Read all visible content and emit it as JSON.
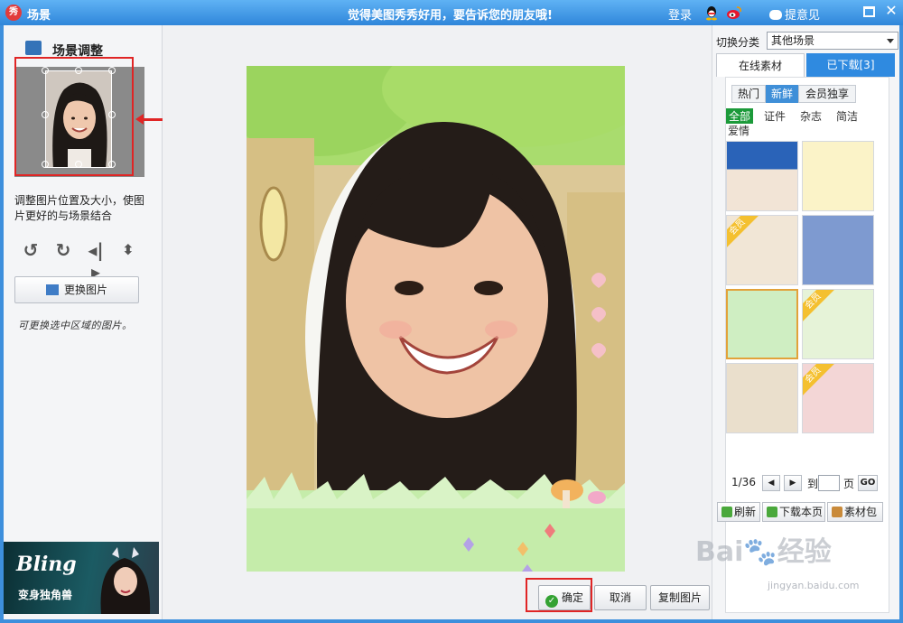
{
  "titlebar": {
    "title": "场景",
    "logo_text": "秀",
    "slogan": "觉得美图秀秀好用，要告诉您的朋友哦!",
    "login": "登录",
    "feedback": "提意见"
  },
  "left": {
    "title": "场景调整",
    "hint": "调整图片位置及大小，使图片更好的与场景结合",
    "replace_button": "更换图片",
    "handwritten": "可更换选中区域的图片。",
    "ad_title": "Bling",
    "ad_subtitle": "变身独角兽"
  },
  "center": {
    "ok": "确定",
    "cancel": "取消",
    "copy": "复制图片"
  },
  "right": {
    "category_label": "切换分类",
    "category_value": "其他场景",
    "tab_online": "在线素材",
    "tab_downloaded": "已下载[3]",
    "filters": [
      "热门",
      "新鲜",
      "会员独享"
    ],
    "active_filter": "新鲜",
    "sub_filters": [
      "全部",
      "证件",
      "杂志",
      "简洁",
      "爱情"
    ],
    "active_sub_filter": "全部",
    "member_tag": "会员",
    "page_text": "1/36",
    "goto_prefix": "到",
    "goto_suffix": "页",
    "go": "GO",
    "refresh": "刷新",
    "download_page": "下载本页",
    "material_pack": "素材包"
  },
  "watermark": {
    "main": "Bai🐾经验",
    "sub": "jingyan.baidu.com"
  }
}
